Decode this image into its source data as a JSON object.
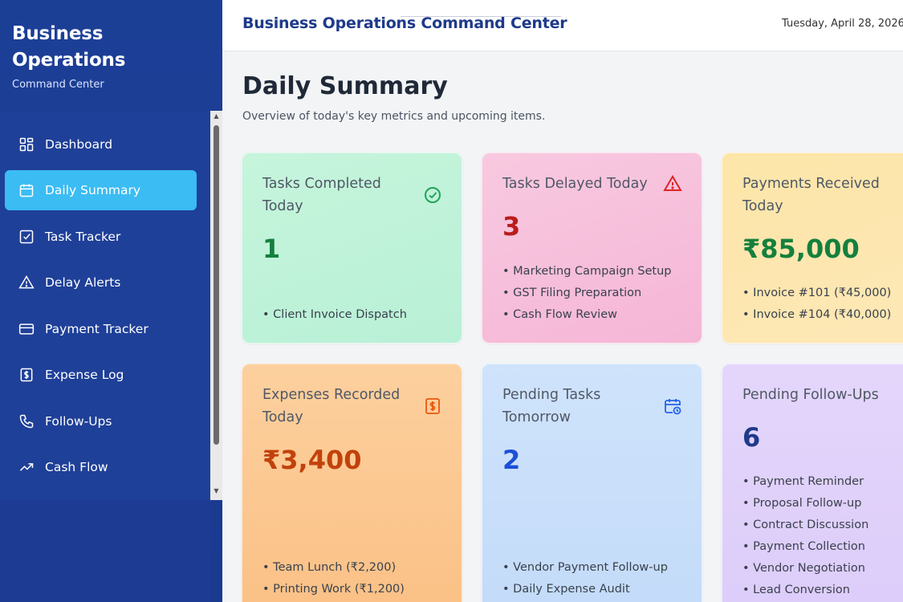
{
  "colors": {
    "sidebar": "#1d3c93",
    "active": "#3bbcf3",
    "header_title": "#1e3a8a",
    "green": "#15803d",
    "red": "#b91c1c",
    "orange": "#c2410c",
    "blue": "#1d4ed8",
    "indigo": "#1e3a8a"
  },
  "sidebar": {
    "title": "Business Operations",
    "subtitle": "Command Center",
    "items": [
      {
        "label": "Dashboard",
        "icon": "grid-icon",
        "active": false
      },
      {
        "label": "Daily Summary",
        "icon": "calendar-icon",
        "active": true
      },
      {
        "label": "Task Tracker",
        "icon": "checkbox-icon",
        "active": false
      },
      {
        "label": "Delay Alerts",
        "icon": "warning-icon",
        "active": false
      },
      {
        "label": "Payment Tracker",
        "icon": "card-icon",
        "active": false
      },
      {
        "label": "Expense Log",
        "icon": "dollar-icon",
        "active": false
      },
      {
        "label": "Follow-Ups",
        "icon": "phone-icon",
        "active": false
      },
      {
        "label": "Cash Flow",
        "icon": "trend-icon",
        "active": false
      }
    ]
  },
  "header": {
    "title": "Business Operations Command Center",
    "date": "Tuesday, April 28, 2026"
  },
  "main": {
    "title": "Daily Summary",
    "subtitle": "Overview of today's key metrics and upcoming items.",
    "cards": [
      {
        "title": "Tasks Completed Today",
        "icon": "check-circle-icon",
        "value": "1",
        "items": [
          "Client Invoice Dispatch"
        ]
      },
      {
        "title": "Tasks Delayed Today",
        "icon": "warning-icon",
        "value": "3",
        "items": [
          "Marketing Campaign Setup",
          "GST Filing Preparation",
          "Cash Flow Review"
        ]
      },
      {
        "title": "Payments Received Today",
        "icon": "rupee-icon",
        "value": "₹85,000",
        "items": [
          "Invoice #101 (₹45,000)",
          "Invoice #104 (₹40,000)"
        ]
      },
      {
        "title": "Expenses Recorded Today",
        "icon": "dollar-icon",
        "value": "₹3,400",
        "items": [
          "Team Lunch (₹2,200)",
          "Printing Work (₹1,200)"
        ]
      },
      {
        "title": "Pending Tasks Tomorrow",
        "icon": "calendar-clock-icon",
        "value": "2",
        "items": [
          "Vendor Payment Follow-up",
          "Daily Expense Audit"
        ]
      },
      {
        "title": "Pending Follow-Ups",
        "icon": "phone-icon",
        "value": "6",
        "items": [
          "Payment Reminder",
          "Proposal Follow-up",
          "Contract Discussion",
          "Payment Collection",
          "Vendor Negotiation",
          "Lead Conversion"
        ]
      }
    ]
  }
}
